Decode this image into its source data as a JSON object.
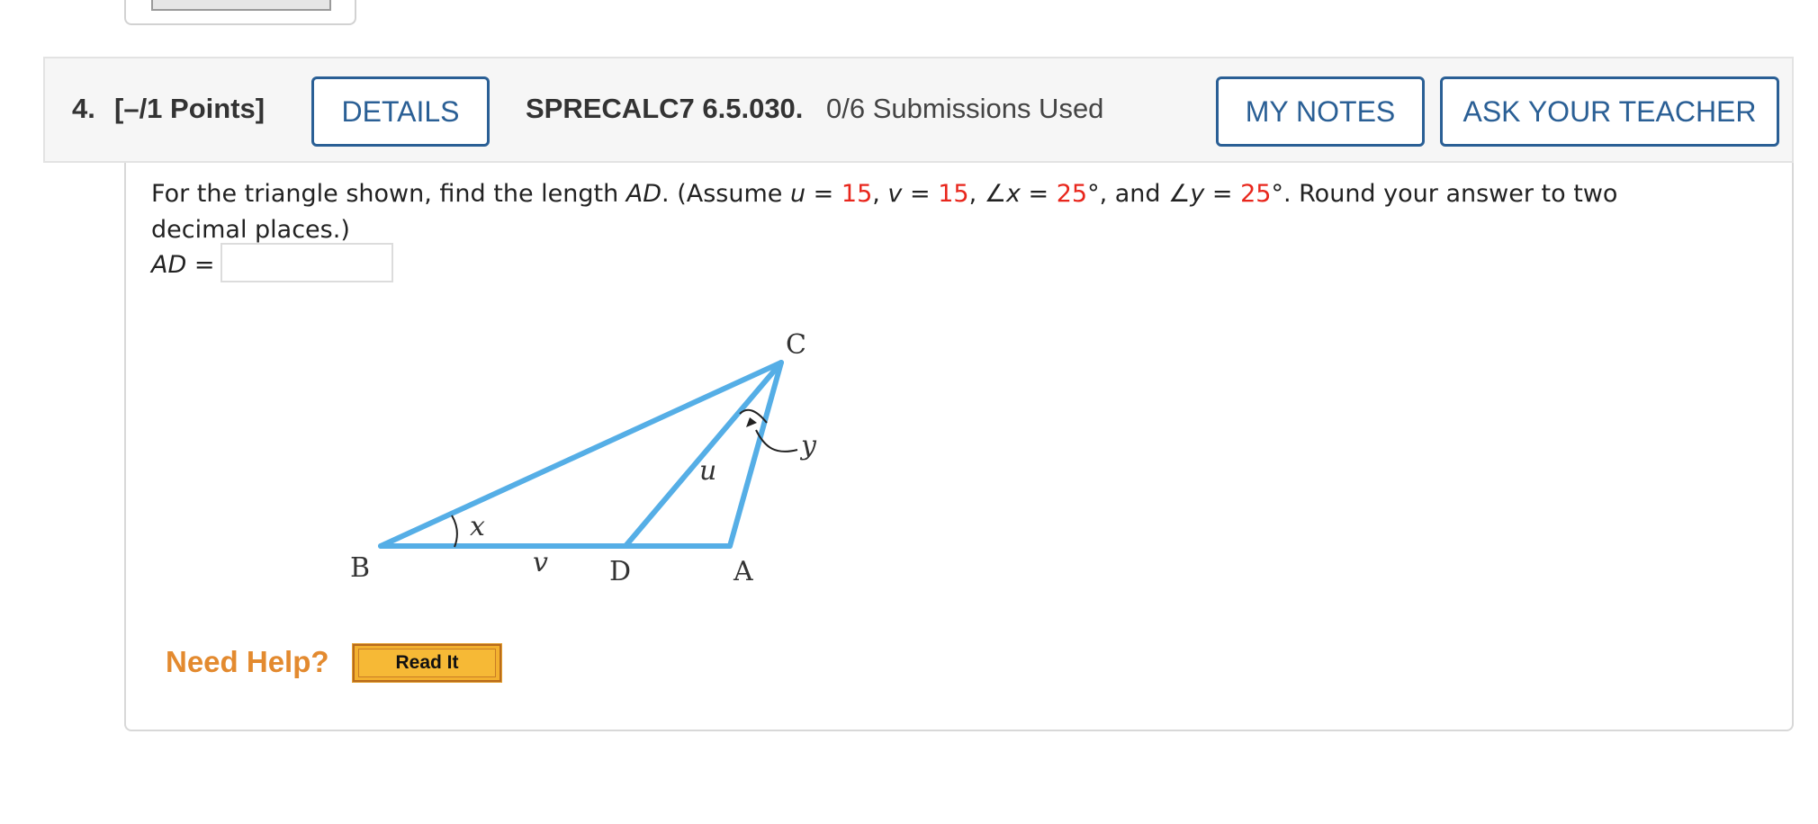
{
  "question": {
    "number": "4.",
    "points": "[–/1 Points]",
    "details_label": "DETAILS",
    "code": "SPRECALC7 6.5.030.",
    "submissions": "0/6 Submissions Used",
    "my_notes_label": "MY NOTES",
    "ask_teacher_label": "ASK YOUR TEACHER"
  },
  "prompt": {
    "t1": "For the triangle shown, find the length ",
    "ad": "AD",
    "t2": ". (Assume ",
    "u": "u",
    "eq1": " = ",
    "u_val": "15",
    "sep1": ", ",
    "v": "v",
    "eq2": " = ",
    "v_val": "15",
    "sep2": ", ",
    "angle_x": "∠x",
    "eq3": " = ",
    "x_val": "25",
    "deg1": "°, and ",
    "angle_y": "∠y",
    "eq4": " = ",
    "y_val": "25",
    "t3": "°. Round your answer to two decimal places.)"
  },
  "answer": {
    "label_var": "AD",
    "label_eq": " =",
    "value": ""
  },
  "figure": {
    "labels": {
      "C": "C",
      "B": "B",
      "D": "D",
      "A": "A",
      "u": "u",
      "v": "v",
      "x": "x",
      "y": "y"
    },
    "line_color": "#55aee6"
  },
  "help": {
    "need_help": "Need Help?",
    "read_it": "Read It"
  },
  "colors": {
    "accent_blue": "#2a5f95",
    "given_red": "#e8261c",
    "help_orange": "#e38a2f"
  }
}
